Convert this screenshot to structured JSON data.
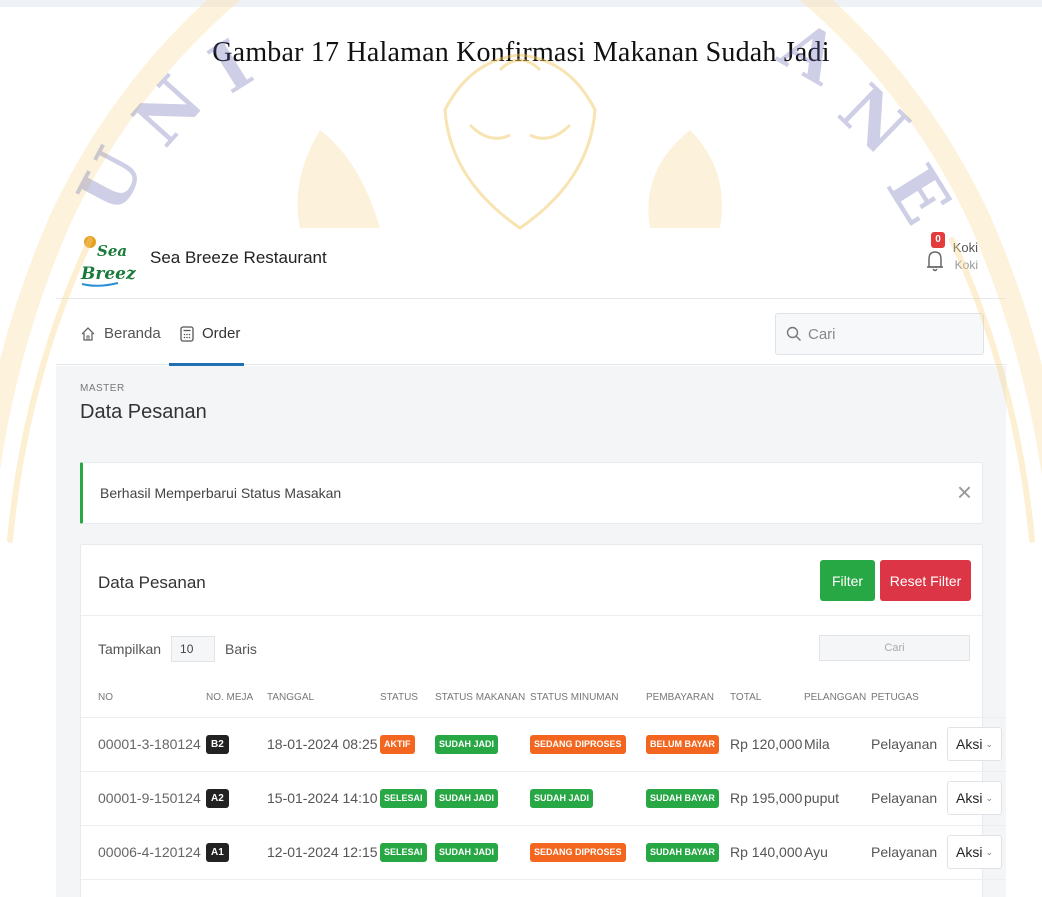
{
  "caption": "Gambar 17 Halaman Konfirmasi Makanan Sudah Jadi",
  "header": {
    "brand": "Sea Breeze Restaurant",
    "notification_count": "0",
    "user_name": "Koki",
    "user_role": "Koki"
  },
  "nav": {
    "items": [
      {
        "label": "Beranda",
        "icon": "home-icon",
        "active": false
      },
      {
        "label": "Order",
        "icon": "calculator-icon",
        "active": true
      }
    ],
    "search_placeholder": "Cari"
  },
  "page": {
    "breadcrumb": "MASTER",
    "title": "Data Pesanan"
  },
  "alert": {
    "message": "Berhasil Memperbarui Status Masakan",
    "close_symbol": "×"
  },
  "card": {
    "title": "Data Pesanan",
    "filter_label": "Filter",
    "reset_label": "Reset Filter",
    "show_label": "Tampilkan",
    "rows_value": "10",
    "rows_suffix": "Baris",
    "search_placeholder": "Cari"
  },
  "table": {
    "columns": [
      "NO",
      "NO. MEJA",
      "TANGGAL",
      "STATUS",
      "STATUS MAKANAN",
      "STATUS MINUMAN",
      "PEMBAYARAN",
      "TOTAL",
      "PELANGGAN",
      "PETUGAS"
    ],
    "rows": [
      {
        "no": "00001-3-180124",
        "meja": "B2",
        "tanggal": "18-01-2024 08:25",
        "status": "AKTIF",
        "status_color": "#f2661f",
        "makanan": "SUDAH JADI",
        "makanan_color": "#28a745",
        "minuman": "SEDANG DIPROSES",
        "minuman_color": "#f2661f",
        "pembayaran": "BELUM BAYAR",
        "pembayaran_color": "#f2661f",
        "total": "Rp 120,000",
        "pelanggan": "Mila",
        "petugas": "Pelayanan",
        "aksi": "Aksi"
      },
      {
        "no": "00001-9-150124",
        "meja": "A2",
        "tanggal": "15-01-2024 14:10",
        "status": "SELESAI",
        "status_color": "#28a745",
        "makanan": "SUDAH JADI",
        "makanan_color": "#28a745",
        "minuman": "SUDAH JADI",
        "minuman_color": "#28a745",
        "pembayaran": "SUDAH BAYAR",
        "pembayaran_color": "#28a745",
        "total": "Rp 195,000",
        "pelanggan": "puput",
        "petugas": "Pelayanan",
        "aksi": "Aksi"
      },
      {
        "no": "00006-4-120124",
        "meja": "A1",
        "tanggal": "12-01-2024 12:15",
        "status": "SELESAI",
        "status_color": "#28a745",
        "makanan": "SUDAH JADI",
        "makanan_color": "#28a745",
        "minuman": "SEDANG DIPROSES",
        "minuman_color": "#f2661f",
        "pembayaran": "SUDAH BAYAR",
        "pembayaran_color": "#28a745",
        "total": "Rp 140,000",
        "pelanggan": "Ayu",
        "petugas": "Pelayanan",
        "aksi": "Aksi"
      }
    ]
  },
  "colors": {
    "success": "#28a745",
    "danger": "#dc3545",
    "warning": "#f2661f",
    "accent": "#1f6fb2",
    "watermark": "#f5c242"
  }
}
